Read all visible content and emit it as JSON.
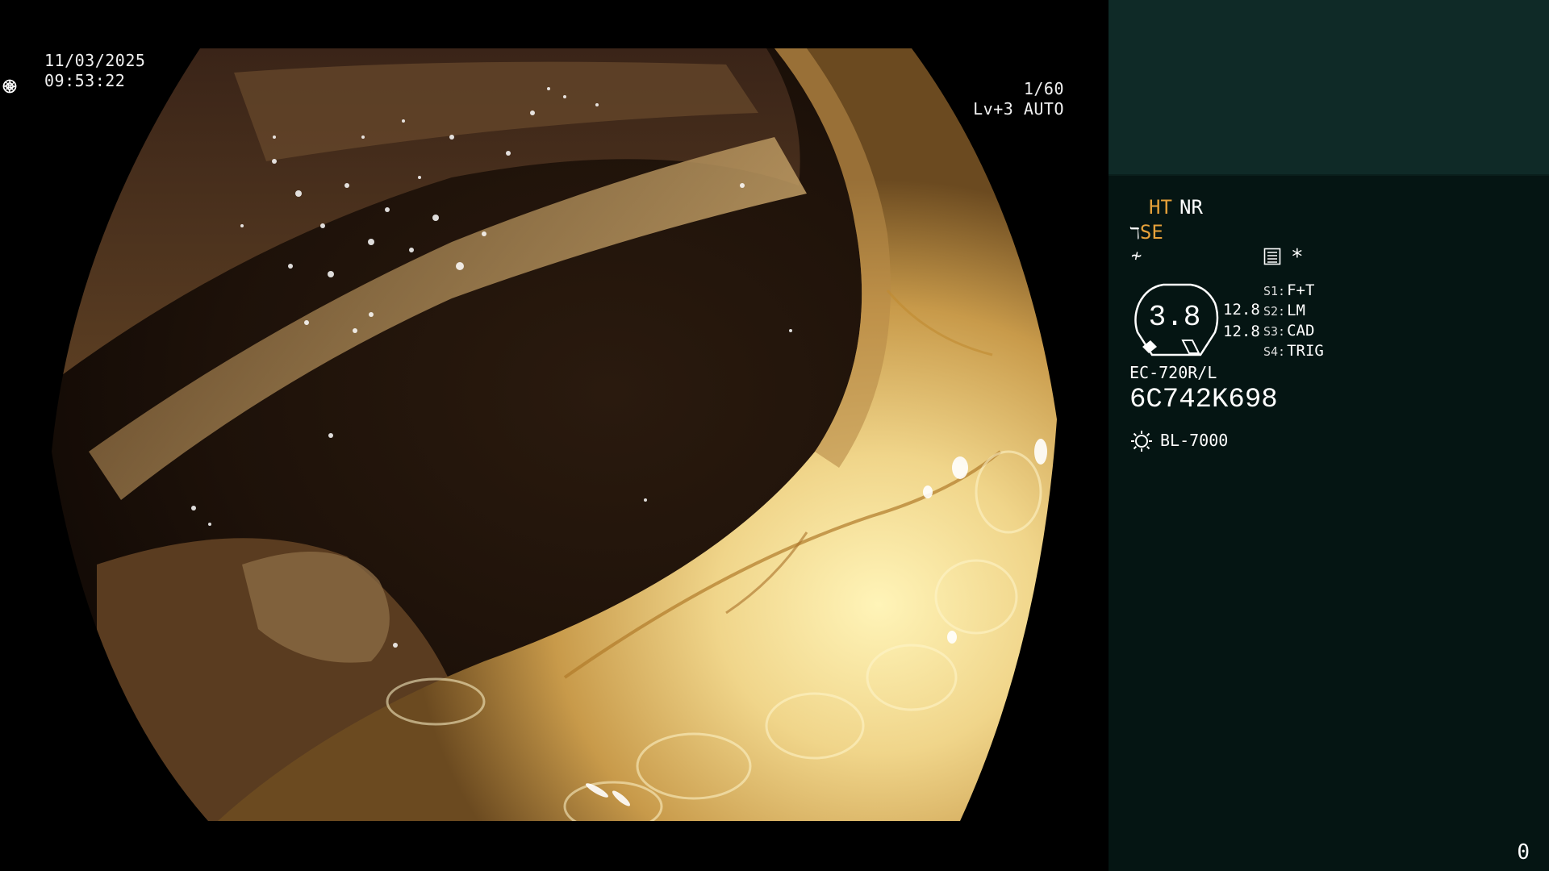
{
  "osd": {
    "date": "11/03/2025",
    "time": "09:53:22",
    "shutter": "1/60",
    "level": "Lv+3 AUTO",
    "shutter_icon": "aperture-icon",
    "auto_icon": "iris-icon"
  },
  "panel": {
    "mode_ht": "HT",
    "mode_nr": "NR",
    "se_label": "SE",
    "star": "*",
    "zoom": "3.8",
    "gain_1": "12.8",
    "gain_2": "12.8",
    "switches": [
      {
        "key": "S1:",
        "value": "F+T"
      },
      {
        "key": "S2:",
        "value": "LM"
      },
      {
        "key": "S3:",
        "value": "CAD"
      },
      {
        "key": "S4:",
        "value": "TRIG"
      }
    ],
    "scope_model": "EC-720R/L",
    "serial": "6C742K698",
    "light_source": "BL-7000",
    "counter": "0",
    "colors": {
      "accent": "#e6a13a",
      "panel_bg": "#051513",
      "thumb_bg": "#0f2a27"
    }
  }
}
